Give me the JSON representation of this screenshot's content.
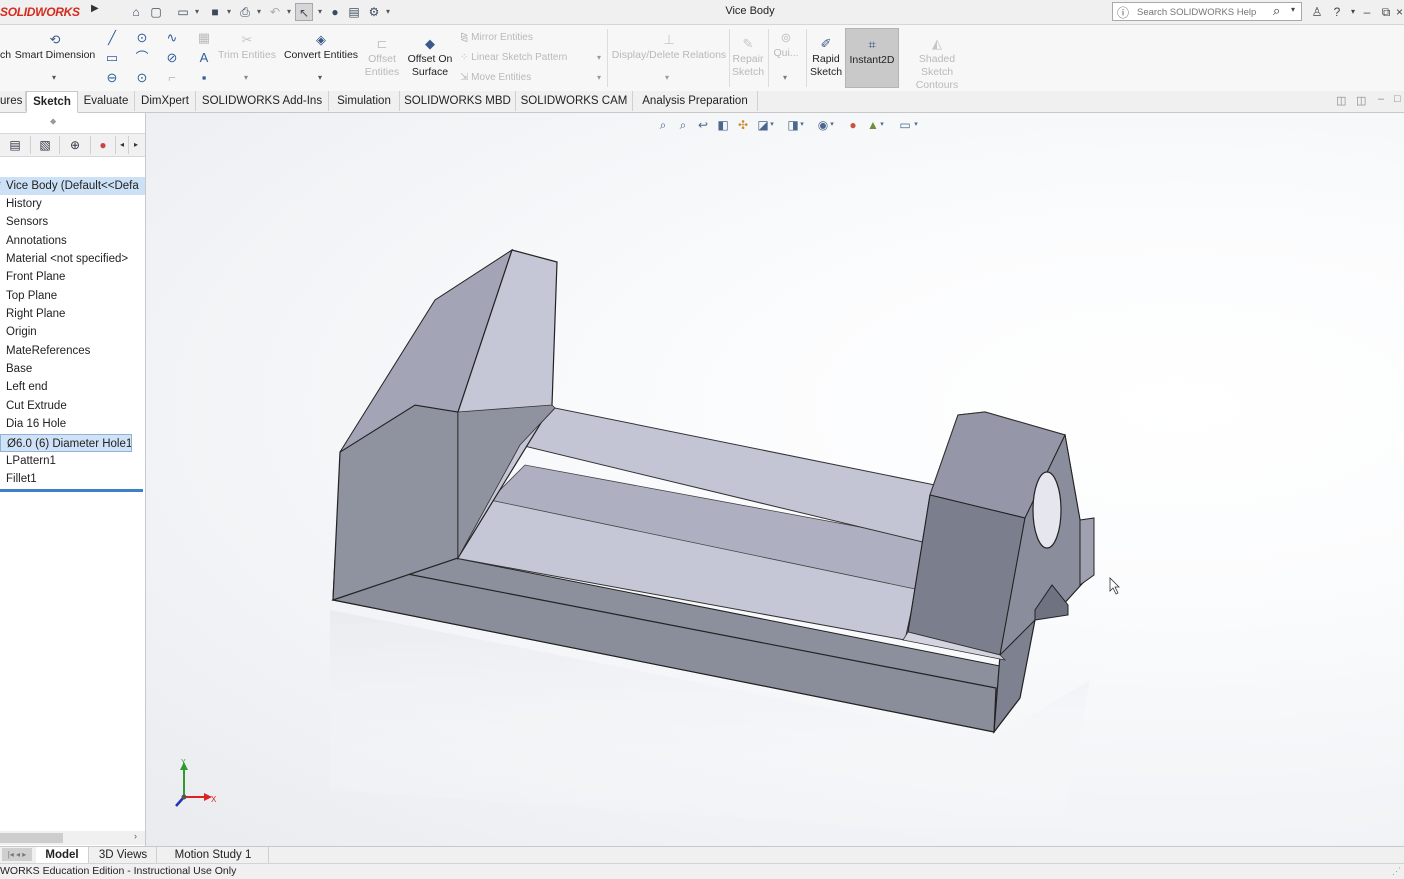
{
  "app": {
    "logo": "SOLIDWORKS",
    "window_title": "Vice Body",
    "help_search_placeholder": "Search SOLIDWORKS Help"
  },
  "ribbon": {
    "sketch_label": "ch",
    "smart_dimension": "Smart Dimension",
    "trim_entities": "Trim Entities",
    "convert_entities": "Convert Entities",
    "offset_entities_1": "Offset",
    "offset_entities_2": "Entities",
    "offset_on_surface_1": "Offset On",
    "offset_on_surface_2": "Surface",
    "mirror_entities": "Mirror Entities",
    "linear_sketch_pattern": "Linear Sketch Pattern",
    "move_entities": "Move Entities",
    "display_delete_relations": "Display/Delete Relations",
    "repair_sketch_1": "Repair",
    "repair_sketch_2": "Sketch",
    "quick_snaps": "Qui...",
    "rapid_sketch_1": "Rapid",
    "rapid_sketch_2": "Sketch",
    "instant2d": "Instant2D",
    "shaded_contours_1": "Shaded Sketch",
    "shaded_contours_2": "Contours"
  },
  "tabs": [
    "ures",
    "Sketch",
    "Evaluate",
    "DimXpert",
    "SOLIDWORKS Add-Ins",
    "Simulation",
    "SOLIDWORKS MBD",
    "SOLIDWORKS CAM",
    "Analysis Preparation"
  ],
  "tree": {
    "root": "Vice Body  (Default<<Defa",
    "items": [
      "History",
      "Sensors",
      "Annotations",
      "Material <not specified>",
      "Front Plane",
      "Top Plane",
      "Right Plane",
      "Origin",
      "MateReferences",
      "Base",
      "Left end",
      "Cut Extrude",
      "Dia 16 Hole",
      "Ø6.0 (6) Diameter Hole1",
      "LPattern1",
      "Fillet1"
    ]
  },
  "triad": {
    "x_label": "X",
    "y_label": "Y"
  },
  "bottom_tabs": [
    "Model",
    "3D Views",
    "Motion Study 1"
  ],
  "status": "WORKS Education Edition - Instructional Use Only"
}
